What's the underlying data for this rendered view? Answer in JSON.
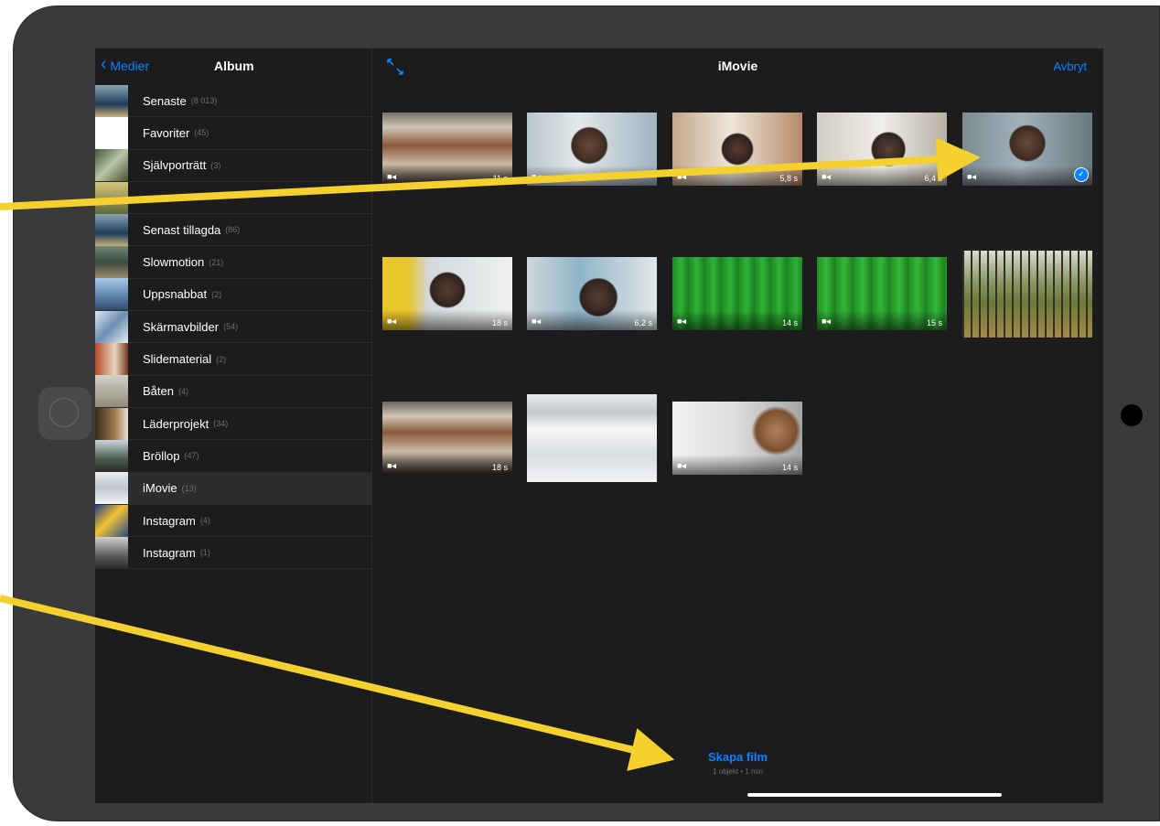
{
  "sidebar": {
    "back_label": "Medier",
    "title": "Album",
    "albums": [
      {
        "name": "Senaste",
        "count": "(8 013)"
      },
      {
        "name": "Favoriter",
        "count": "(45)"
      },
      {
        "name": "Självporträtt",
        "count": "(3)"
      },
      {
        "name": "",
        "count": ""
      },
      {
        "name": "Senast tillagda",
        "count": "(86)"
      },
      {
        "name": "Slowmotion",
        "count": "(21)"
      },
      {
        "name": "Uppsnabbat",
        "count": "(2)"
      },
      {
        "name": "Skärmavbilder",
        "count": "(54)"
      },
      {
        "name": "Slidematerial",
        "count": "(2)"
      },
      {
        "name": "Båten",
        "count": "(4)"
      },
      {
        "name": "Läderprojekt",
        "count": "(34)"
      },
      {
        "name": "Bröllop",
        "count": "(47)"
      },
      {
        "name": "iMovie",
        "count": "(13)"
      },
      {
        "name": "Instagram",
        "count": "(4)"
      },
      {
        "name": "Instagram",
        "count": "(1)"
      }
    ]
  },
  "main": {
    "title": "iMovie",
    "cancel_label": "Avbryt",
    "media": [
      {
        "duration": "11 s"
      },
      {
        "duration": ""
      },
      {
        "duration": "5,8 s"
      },
      {
        "duration": "6,4 s"
      },
      {
        "duration": "",
        "selected": true
      },
      {
        "duration": "18 s"
      },
      {
        "duration": "6,2 s"
      },
      {
        "duration": "14 s"
      },
      {
        "duration": "15 s"
      },
      {
        "duration": ""
      },
      {
        "duration": "18 s"
      },
      {
        "duration": ""
      },
      {
        "duration": "14 s"
      }
    ],
    "create_label": "Skapa film",
    "create_subtitle": "1 objekt • 1 min"
  },
  "colors": {
    "accent": "#0a84ff",
    "arrow": "#f5d130",
    "background": "#1c1c1e"
  }
}
